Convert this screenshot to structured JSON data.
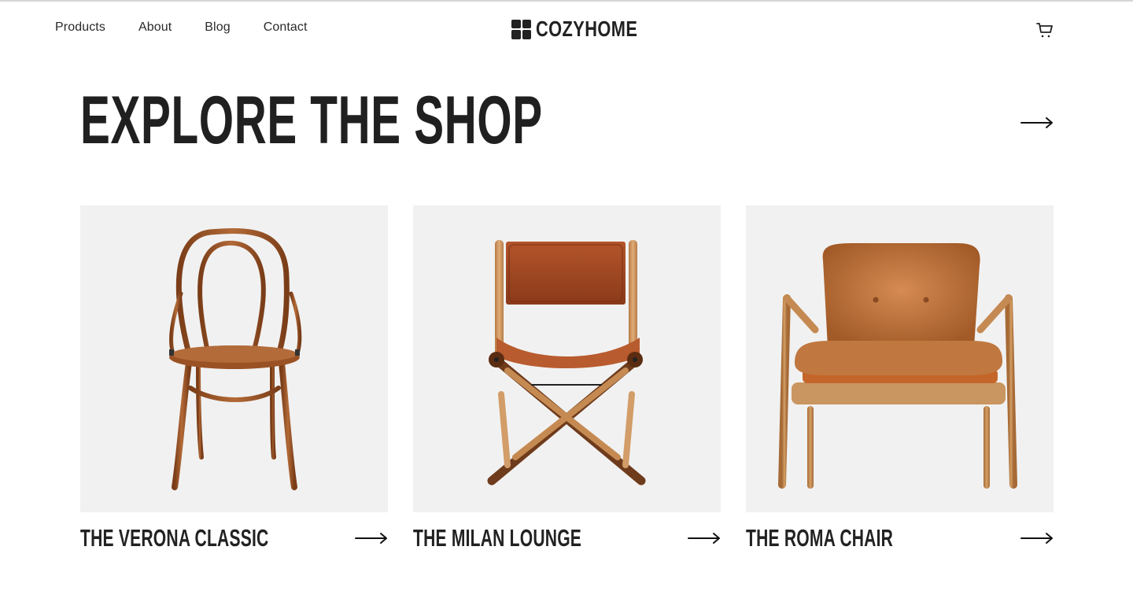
{
  "nav": {
    "items": [
      {
        "label": "Products"
      },
      {
        "label": "About"
      },
      {
        "label": "Blog"
      },
      {
        "label": "Contact"
      }
    ]
  },
  "brand": {
    "name": "COZYHOME",
    "icon": "four-squares-logo-icon"
  },
  "header": {
    "cart_icon": "shopping-cart-icon"
  },
  "hero": {
    "title": "EXPLORE THE SHOP",
    "arrow_icon": "arrow-right-icon"
  },
  "products": [
    {
      "name": "THE VERONA CLASSIC",
      "image": "bentwood-cafe-chair",
      "arrow_icon": "arrow-right-icon"
    },
    {
      "name": "THE MILAN LOUNGE",
      "image": "leather-director-chair",
      "arrow_icon": "arrow-right-icon"
    },
    {
      "name": "THE ROMA CHAIR",
      "image": "leather-lounge-armchair",
      "arrow_icon": "arrow-right-icon"
    }
  ],
  "colors": {
    "text": "#222222",
    "card_bg": "#f1f1f1",
    "wood": "#8a4a22",
    "leather": "#b8612e"
  }
}
